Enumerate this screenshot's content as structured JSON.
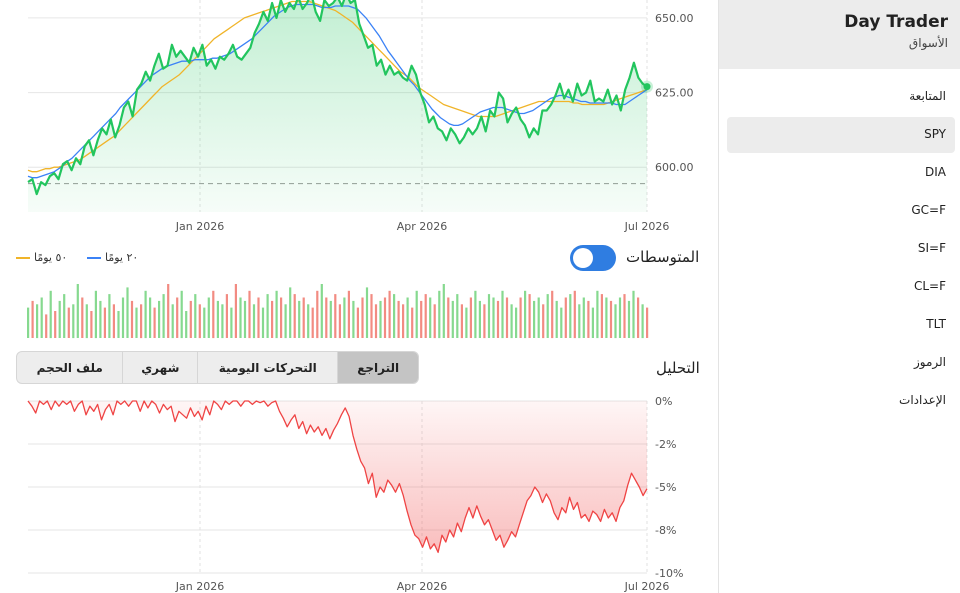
{
  "app": {
    "title": "Day Trader",
    "subtitle": "الأسواق"
  },
  "sidebar": {
    "items": [
      {
        "label": "المتابعة"
      },
      {
        "label": "SPY",
        "selected": true
      },
      {
        "label": "DIA"
      },
      {
        "label": "GC=F"
      },
      {
        "label": "SI=F"
      },
      {
        "label": "CL=F"
      },
      {
        "label": "TLT"
      },
      {
        "label": "الرموز"
      },
      {
        "label": "الإعدادات"
      }
    ]
  },
  "controls": {
    "ma_label": "المتوسطات",
    "ma_toggle_on": true,
    "legend": [
      {
        "label": "٢٠ يومًا",
        "color": "#3b82f6"
      },
      {
        "label": "٥٠ يومًا",
        "color": "#f0b429"
      }
    ],
    "analysis_label": "التحليل",
    "tabs": [
      "التراجع",
      "التحركات اليومية",
      "شهري",
      "ملف الحجم"
    ],
    "selected_tab": "التراجع"
  },
  "colors": {
    "price": "#22c55e",
    "ma20": "#3b82f6",
    "ma50": "#f0b429",
    "drawdown": "#ef4444",
    "vol_up": "#86d98f",
    "vol_down": "#f28b82"
  },
  "chart_data": [
    {
      "type": "line",
      "name": "price",
      "x_ticks": [
        "Jan 2026",
        "Apr 2026",
        "Jul 2026"
      ],
      "y_ticks": [
        "600.00",
        "625.00",
        "650.00"
      ],
      "ylim": [
        585,
        656
      ],
      "reference_line": 594.5,
      "series": [
        {
          "key": "price",
          "values": [
            595,
            596,
            591,
            595,
            594,
            597,
            598,
            596,
            601,
            602,
            599,
            603,
            601,
            607,
            609,
            604,
            609,
            613,
            611,
            616,
            610,
            614,
            620,
            622,
            617,
            626,
            628,
            632,
            629,
            634,
            638,
            633,
            634,
            641,
            637,
            639,
            637,
            635,
            640,
            637,
            641,
            634,
            636,
            633,
            637,
            636,
            638,
            641,
            637,
            636,
            638,
            640,
            645,
            648,
            652,
            649,
            655,
            650,
            656,
            652,
            655,
            653,
            657,
            653,
            655,
            658,
            652,
            649,
            656,
            654,
            655,
            657,
            654,
            658,
            655,
            656,
            648,
            644,
            640,
            641,
            634,
            636,
            631,
            634,
            631,
            632,
            630,
            629,
            634,
            631,
            625,
            621,
            615,
            617,
            613,
            612,
            609,
            613,
            611,
            608,
            610,
            613,
            611,
            613,
            617,
            612,
            619,
            617,
            625,
            623,
            615,
            618,
            620,
            616,
            614,
            610,
            613,
            611,
            619,
            619,
            621,
            624,
            628,
            623,
            626,
            622,
            628,
            624,
            625,
            629,
            622,
            623,
            622,
            626,
            621,
            624,
            619,
            626,
            630,
            635,
            630,
            628,
            627
          ]
        },
        {
          "key": "ma20",
          "values": [
            597,
            596.5,
            596.5,
            597,
            597.5,
            598,
            598.5,
            599.5,
            600.5,
            602,
            603,
            604.5,
            606,
            607.5,
            609,
            610.5,
            612,
            613.5,
            615,
            616.5,
            618,
            620,
            621.5,
            623,
            624.5,
            626,
            627.5,
            629,
            630.5,
            631.5,
            632.5,
            633.5,
            634,
            634.5,
            635,
            635.5,
            635.5,
            635.5,
            636,
            636,
            636,
            636,
            636.5,
            636.5,
            637,
            637.5,
            638,
            639,
            640,
            641,
            642,
            643,
            644.5,
            646,
            647.5,
            649,
            650.5,
            651.5,
            652.5,
            653.5,
            654,
            654.5,
            654.5,
            654.5,
            654.5,
            654.5,
            654,
            653.5,
            653.5,
            653.5,
            654,
            654,
            654,
            654,
            653.5,
            653,
            651.5,
            650,
            648,
            646,
            644,
            641.5,
            639,
            637,
            635,
            633,
            631,
            629,
            627.5,
            625.5,
            623.5,
            621.5,
            619.5,
            618,
            616.5,
            615.5,
            614.5,
            614,
            614,
            614.5,
            615.5,
            616.5,
            617.5,
            618.5,
            619,
            619.5,
            620,
            620,
            620,
            619.5,
            619,
            618.5,
            618,
            618,
            618.5,
            619,
            620,
            621,
            622,
            623,
            623.5,
            624,
            624,
            623.5,
            623,
            622.5,
            622,
            622,
            621.5,
            621.5,
            621.5,
            621.5,
            621.5,
            621.5,
            621,
            621,
            621,
            622,
            623,
            624,
            625,
            626
          ]
        },
        {
          "key": "ma50",
          "values": [
            599,
            598.5,
            598.5,
            599,
            599.5,
            599.5,
            600,
            600,
            600.5,
            601,
            601.5,
            602,
            602.5,
            603.5,
            604.5,
            605.5,
            606.5,
            607.5,
            608.5,
            609.5,
            610.5,
            612,
            613.5,
            615,
            616.5,
            618,
            619.5,
            621,
            622.5,
            624,
            625.5,
            627,
            628,
            629,
            630,
            631,
            632.5,
            634,
            635.5,
            637,
            638.5,
            640,
            641.5,
            643,
            644,
            645,
            646,
            647,
            648,
            649,
            650,
            650.5,
            651,
            651.5,
            652,
            652.5,
            653,
            653.5,
            654,
            654.5,
            655,
            655.5,
            655.5,
            655.5,
            655.5,
            655.5,
            655,
            654.5,
            654,
            653.5,
            653,
            652.5,
            651.5,
            650.5,
            649.5,
            648.5,
            647,
            645.5,
            644,
            642.5,
            641,
            639.5,
            638,
            636.5,
            635,
            633.5,
            632,
            631,
            630,
            628.5,
            627,
            626,
            625,
            624,
            623,
            622,
            621,
            620.5,
            620,
            619.5,
            619,
            618.5,
            618,
            617.5,
            617,
            617,
            617,
            617,
            617,
            617.5,
            618,
            618.5,
            619,
            619.5,
            620,
            620.5,
            621,
            621.5,
            622,
            622,
            622,
            622,
            622,
            622,
            622,
            622,
            621.5,
            621.5,
            621,
            621,
            621,
            621,
            621,
            621,
            621.5,
            622,
            622.5,
            623,
            623.5,
            624,
            624.5,
            625,
            625.5,
            626
          ]
        }
      ]
    },
    {
      "type": "bar",
      "name": "volume",
      "values": [
        45,
        55,
        50,
        60,
        35,
        70,
        40,
        55,
        65,
        45,
        50,
        80,
        60,
        50,
        40,
        70,
        55,
        45,
        65,
        50,
        40,
        60,
        75,
        55,
        45,
        50,
        70,
        60,
        45,
        55,
        65,
        80,
        50,
        60,
        70,
        40,
        55,
        65,
        50,
        45,
        60,
        70,
        55,
        50,
        65,
        45,
        80,
        60,
        55,
        70,
        50,
        60,
        45,
        65,
        55,
        70,
        60,
        50,
        75,
        65,
        55,
        60,
        50,
        45,
        70,
        80,
        60,
        55,
        65,
        50,
        60,
        70,
        55,
        45,
        60,
        75,
        65,
        50,
        55,
        60,
        70,
        65,
        55,
        50,
        60,
        45,
        70,
        55,
        65,
        60,
        50,
        70,
        80,
        60,
        55,
        65,
        50,
        45,
        60,
        70,
        55,
        50,
        65,
        60,
        55,
        70,
        60,
        50,
        45,
        60,
        70,
        65,
        55,
        60,
        50,
        65,
        70,
        55,
        45,
        60,
        65,
        70,
        50,
        60,
        55,
        45,
        70,
        65,
        60,
        55,
        50,
        60,
        65,
        55,
        70,
        60,
        50,
        45
      ],
      "up": [
        1,
        0,
        1,
        1,
        0,
        1,
        0,
        1,
        1,
        0,
        1,
        1,
        0,
        1,
        0,
        1,
        1,
        0,
        1,
        0,
        1,
        1,
        1,
        0,
        1,
        0,
        1,
        1,
        0,
        1,
        1,
        0,
        1,
        0,
        1,
        1,
        0,
        1,
        0,
        1,
        1,
        0,
        1,
        1,
        0,
        1,
        0,
        1,
        1,
        0,
        1,
        0,
        1,
        1,
        0,
        1,
        0,
        1,
        1,
        0,
        1,
        0,
        1,
        0,
        0,
        1,
        0,
        1,
        0,
        0,
        1,
        0,
        1,
        0,
        0,
        1,
        0,
        0,
        1,
        0,
        0,
        1,
        0,
        0,
        1,
        0,
        1,
        0,
        0,
        1,
        0,
        1,
        1,
        0,
        1,
        1,
        0,
        1,
        0,
        1,
        1,
        0,
        1,
        1,
        0,
        1,
        0,
        1,
        1,
        0,
        1,
        0,
        1,
        1,
        0,
        1,
        0,
        1,
        1,
        0,
        1,
        0,
        1,
        1,
        0,
        1,
        1,
        0,
        1,
        0,
        1,
        1,
        0,
        1,
        1,
        0,
        1,
        0
      ]
    },
    {
      "type": "area",
      "name": "drawdown",
      "x_ticks": [
        "Jan 2026",
        "Apr 2026",
        "Jul 2026"
      ],
      "y_ticks": [
        "0%",
        "-2%",
        "-5%",
        "-8%",
        "-10%"
      ],
      "ylim": [
        -10,
        0
      ],
      "values": [
        0,
        -0.3,
        -0.7,
        0,
        -0.2,
        0,
        -0.5,
        0,
        -0.3,
        0,
        -0.2,
        0,
        -0.6,
        -0.2,
        0,
        -0.8,
        -0.3,
        -0.6,
        -0.2,
        -1.1,
        -0.5,
        -0.2,
        -0.8,
        0,
        -0.2,
        0,
        -0.3,
        0,
        0,
        -0.6,
        0,
        -0.4,
        0,
        -0.2,
        -0.7,
        -0.2,
        -0.5,
        -0.3,
        -1.2,
        -0.6,
        -0.8,
        -1.0,
        -0.4,
        -0.9,
        -0.6,
        -1.1,
        -0.3,
        -0.8,
        0,
        -0.2,
        -0.5,
        0,
        -0.2,
        0,
        0,
        -0.3,
        0,
        0,
        -0.2,
        0,
        -0.1,
        0,
        -0.3,
        -0.1,
        0,
        -0.6,
        -1.0,
        -1.5,
        -1.1,
        -0.8,
        -1.6,
        -1.2,
        -1.9,
        -1.4,
        -1.8,
        -1.5,
        -2.0,
        -1.6,
        -2.2,
        -1.7,
        -1.3,
        -0.8,
        -0.4,
        -0.9,
        -2.0,
        -2.8,
        -3.5,
        -3.9,
        -4.8,
        -4.2,
        -5.6,
        -5.0,
        -5.3,
        -4.6,
        -4.9,
        -5.3,
        -4.8,
        -5.5,
        -6.4,
        -7.2,
        -7.8,
        -8.0,
        -8.5,
        -7.9,
        -8.6,
        -8.3,
        -8.8,
        -7.8,
        -8.2,
        -7.5,
        -7.9,
        -7.1,
        -7.6,
        -6.8,
        -6.2,
        -6.8,
        -6.1,
        -6.7,
        -7.2,
        -6.9,
        -7.5,
        -8.1,
        -7.8,
        -8.5,
        -8.1,
        -7.6,
        -7.9,
        -7.2,
        -6.5,
        -5.8,
        -5.5,
        -5.0,
        -5.3,
        -5.9,
        -5.4,
        -5.8,
        -6.5,
        -6.9,
        -6.2,
        -6.5,
        -5.6,
        -6.3,
        -5.9,
        -6.8,
        -6.6,
        -7.0,
        -6.4,
        -6.6,
        -7.0,
        -6.3,
        -6.8,
        -6.5,
        -7.0,
        -6.2,
        -5.8,
        -4.9,
        -4.2,
        -4.6,
        -5.0,
        -5.5,
        -5.1
      ]
    }
  ]
}
